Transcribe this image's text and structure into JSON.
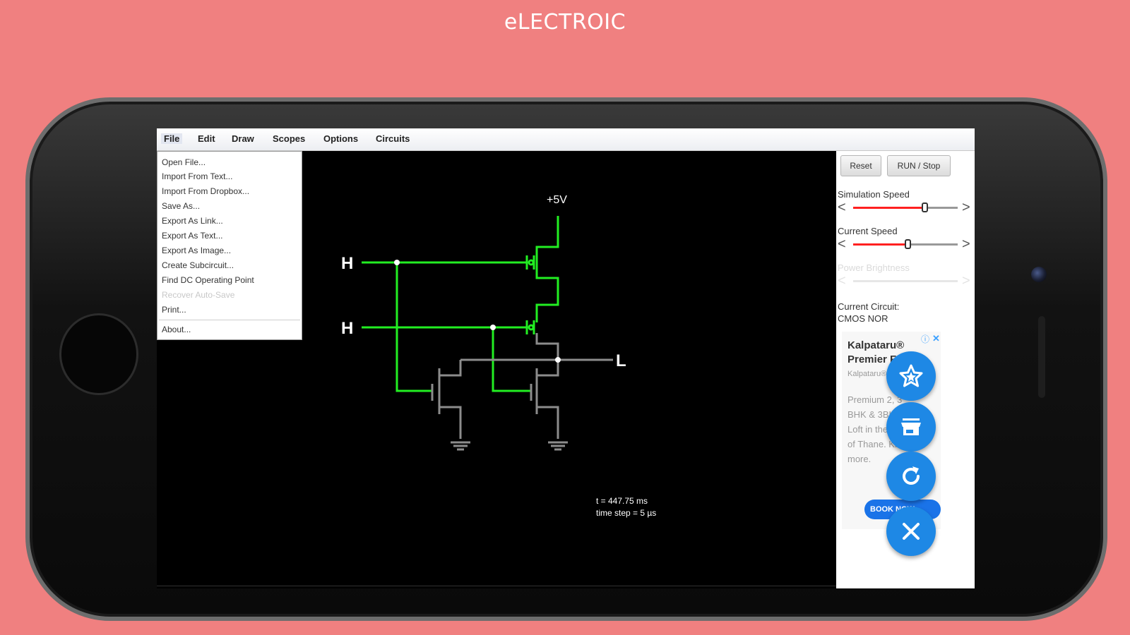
{
  "promo": {
    "title": "eLECTROIC"
  },
  "menubar": {
    "items": [
      "File",
      "Edit",
      "Draw",
      "Scopes",
      "Options",
      "Circuits"
    ]
  },
  "file_menu": {
    "items": [
      {
        "label": "Open File..."
      },
      {
        "label": "Import From Text..."
      },
      {
        "label": "Import From Dropbox..."
      },
      {
        "label": "Save As..."
      },
      {
        "label": "Export As Link..."
      },
      {
        "label": "Export As Text..."
      },
      {
        "label": "Export As Image..."
      },
      {
        "label": "Create Subcircuit..."
      },
      {
        "label": "Find DC Operating Point"
      },
      {
        "label": "Recover Auto-Save",
        "disabled": true
      },
      {
        "label": "Print..."
      },
      {
        "label": "About..."
      }
    ]
  },
  "circuit": {
    "supply_label": "+5V",
    "input_a_label": "H",
    "input_b_label": "H",
    "output_label": "L",
    "wire_high_color": "#22ee22",
    "wire_low_color": "#8c8c8c",
    "time_text": "t = 447.75 ms",
    "timestep_text": "time step = 5 µs"
  },
  "controls": {
    "reset_label": "Reset",
    "run_stop_label": "RUN / Stop",
    "sliders": [
      {
        "label": "Simulation Speed",
        "value": 0.68,
        "enabled": true
      },
      {
        "label": "Current Speed",
        "value": 0.52,
        "enabled": true
      },
      {
        "label": "Power Brightness",
        "value": 0.5,
        "enabled": false
      }
    ],
    "current_circuit_label": "Current Circuit:",
    "current_circuit_name": "CMOS NOR"
  },
  "ad": {
    "title_line1": "Kalpataru®",
    "title_line2": "Premier Fe",
    "brand": "Kalpataru®",
    "body_lines": [
      "Premium 2, 3",
      "BHK & 3BH",
      "Loft in the",
      "of Thane. Kn",
      "more."
    ],
    "cta": "BOOK NOW"
  },
  "fabs": [
    {
      "icon": "star-icon"
    },
    {
      "icon": "store-icon"
    },
    {
      "icon": "refresh-icon"
    },
    {
      "icon": "close-icon"
    }
  ],
  "colors": {
    "background": "#f08080",
    "fab": "#1e88e5",
    "slider_fill": "#ff2020"
  }
}
